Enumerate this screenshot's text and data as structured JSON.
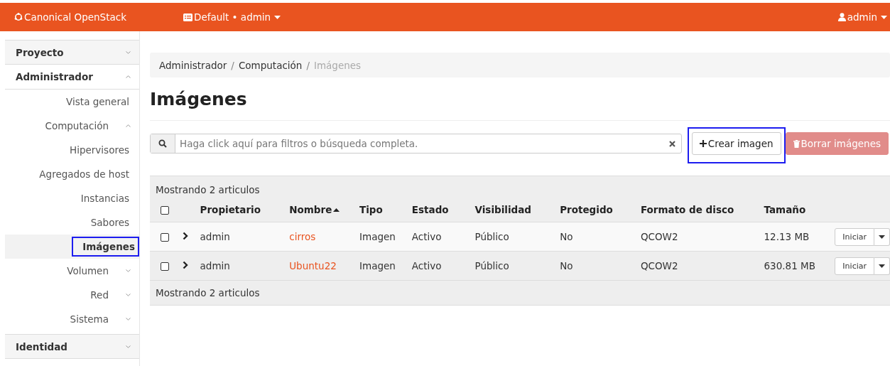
{
  "navbar": {
    "brand": "Canonical OpenStack",
    "project_menu": "Default • admin",
    "user_menu": "admin"
  },
  "sidebar": {
    "items": [
      {
        "label": "Proyecto",
        "expanded": false,
        "selected": false,
        "highlighted": false
      },
      {
        "label": "Administrador",
        "expanded": true,
        "selected": false,
        "highlighted": false,
        "children": [
          {
            "label": "Vista general",
            "selected": false,
            "highlighted": false
          },
          {
            "label": "Computación",
            "expanded": true,
            "selected": false,
            "highlighted": false,
            "children": [
              {
                "label": "Hipervisores",
                "selected": false,
                "highlighted": false
              },
              {
                "label": "Agregados de host",
                "selected": false,
                "highlighted": false
              },
              {
                "label": "Instancias",
                "selected": false,
                "highlighted": false
              },
              {
                "label": "Sabores",
                "selected": false,
                "highlighted": false
              },
              {
                "label": "Imágenes",
                "selected": true,
                "highlighted": true
              }
            ]
          },
          {
            "label": "Volumen",
            "expanded": false,
            "selected": false,
            "highlighted": false
          },
          {
            "label": "Red",
            "expanded": false,
            "selected": false,
            "highlighted": false
          },
          {
            "label": "Sistema",
            "expanded": false,
            "selected": false,
            "highlighted": false
          }
        ]
      },
      {
        "label": "Identidad",
        "expanded": false,
        "selected": false,
        "highlighted": false
      }
    ]
  },
  "breadcrumb": [
    {
      "label": "Administrador"
    },
    {
      "separator": "/",
      "label": "Computación"
    },
    {
      "separator": "/",
      "label": "Imágenes"
    }
  ],
  "page_title": "Imágenes",
  "search": {
    "placeholder": "Haga click aquí para filtros o búsqueda completa."
  },
  "buttons": [
    {
      "label": "Crear imagen",
      "kind": "create",
      "highlighted": true,
      "disabled": false
    },
    {
      "label": "Borrar imágenes",
      "kind": "delete",
      "highlighted": false,
      "disabled": true
    }
  ],
  "table": {
    "summary_top": "Mostrando 2 articulos",
    "select_all": {
      "checked": false
    },
    "columns": [
      {
        "label": "Propietario",
        "sorted": false
      },
      {
        "label": "Nombre",
        "sorted": true
      },
      {
        "label": "Tipo",
        "sorted": false
      },
      {
        "label": "Estado",
        "sorted": false
      },
      {
        "label": "Visibilidad",
        "sorted": false
      },
      {
        "label": "Protegido",
        "sorted": false
      },
      {
        "label": "Formato de disco",
        "sorted": false
      },
      {
        "label": "Tamaño",
        "sorted": false
      }
    ],
    "rows": [
      {
        "checked": false,
        "expanded": false,
        "cells": [
          "admin",
          "cirros",
          "Imagen",
          "Activo",
          "Público",
          "No",
          "QCOW2",
          "12.13 MB"
        ],
        "action": "Iniciar"
      },
      {
        "checked": false,
        "expanded": false,
        "cells": [
          "admin",
          "Ubuntu22",
          "Imagen",
          "Activo",
          "Público",
          "No",
          "QCOW2",
          "630.81 MB"
        ],
        "action": "Iniciar"
      }
    ],
    "summary_bottom": "Mostrando 2 articulos"
  }
}
